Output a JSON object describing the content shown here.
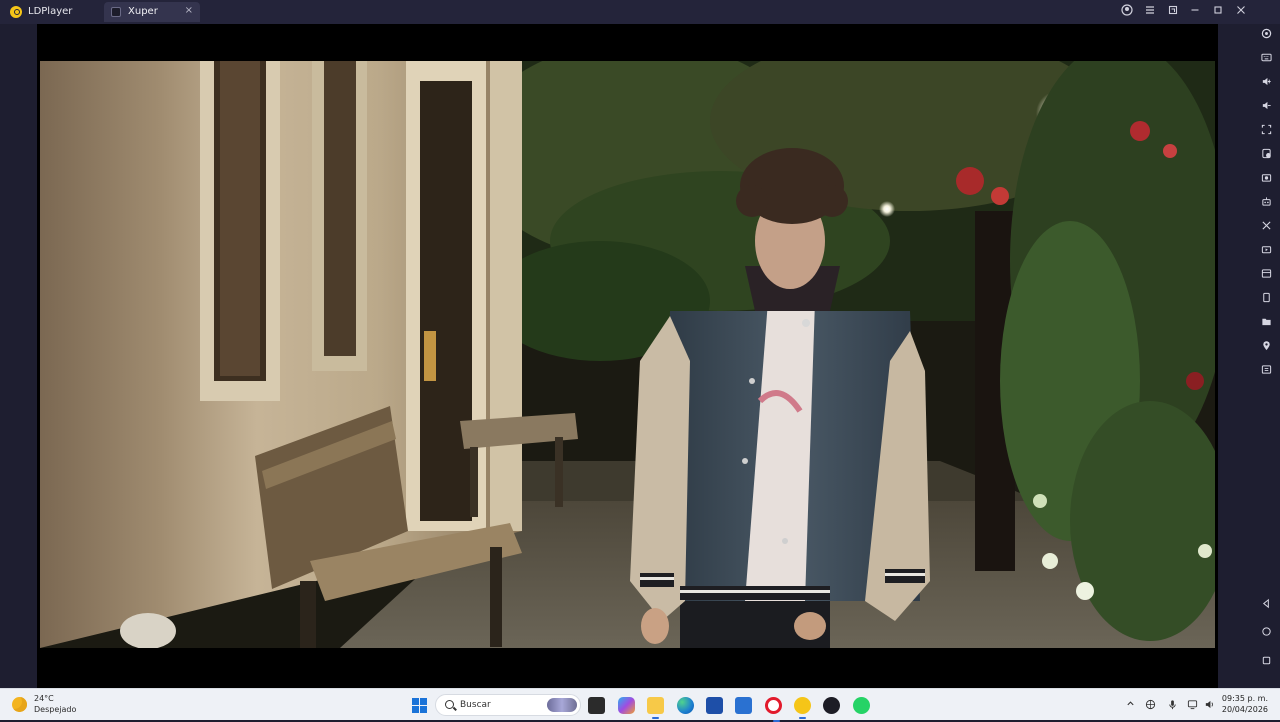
{
  "titlebar": {
    "app_name": "LDPlayer",
    "tab_label": "Xuper",
    "tab_close": "×",
    "window_controls": [
      "account-icon",
      "menu-icon",
      "restore-icon",
      "minimize-icon",
      "maximize-icon",
      "close-icon"
    ]
  },
  "sidebar": {
    "items": [
      "settings-icon",
      "keyboard-icon",
      "volume-up-icon",
      "volume-down-icon",
      "fullscreen-icon",
      "apk-install-icon",
      "screenshot-icon",
      "robot-icon",
      "scissors-icon",
      "record-icon",
      "multi-instance-icon",
      "sync-icon",
      "folder-icon",
      "location-icon",
      "operations-icon",
      "back-icon",
      "home-icon",
      "recents-icon"
    ]
  },
  "taskbar": {
    "weather_temp": "24°C",
    "weather_condition": "Despejado",
    "search_placeholder": "Buscar",
    "apps": [
      "start-icon",
      "file-explorer-icon",
      "copilot-icon",
      "folder-icon",
      "edge-icon",
      "store-icon",
      "outlook-icon",
      "opera-icon",
      "ldplayer-icon",
      "app-icon",
      "whatsapp-icon"
    ],
    "clock_time": "09:35 p. m.",
    "clock_date": "20/04/2026"
  }
}
